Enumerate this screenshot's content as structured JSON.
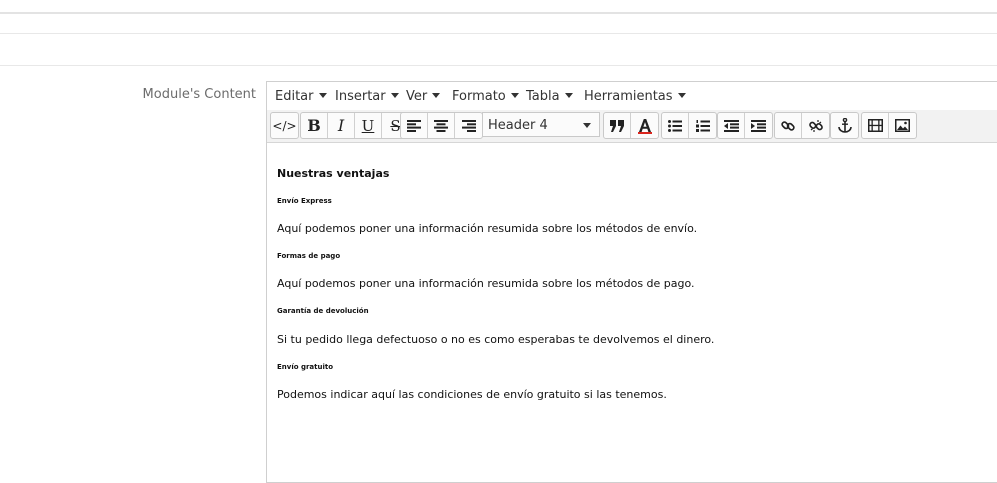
{
  "form": {
    "label": "Module's Content"
  },
  "menubar": {
    "items": [
      "Editar",
      "Insertar",
      "Ver",
      "Formato",
      "Tabla",
      "Herramientas"
    ]
  },
  "toolbar": {
    "source_code_icon": "</>",
    "bold": "B",
    "italic": "I",
    "underline": "U",
    "strikethrough": "S",
    "format_select": "Header 4",
    "icons": [
      "code-icon",
      "bold-icon",
      "italic-icon",
      "underline-icon",
      "strikethrough-icon",
      "align-left-icon",
      "align-center-icon",
      "align-right-icon",
      "blockquote-icon",
      "text-color-icon",
      "bullet-list-icon",
      "numbered-list-icon",
      "outdent-icon",
      "indent-icon",
      "link-icon",
      "unlink-icon",
      "anchor-icon",
      "media-icon",
      "image-icon"
    ],
    "text_color_accent": "#d9241c"
  },
  "content": {
    "title": "Nuestras ventajas",
    "sections": [
      {
        "heading": "Envío Express",
        "text": "Aquí podemos poner una información resumida sobre los métodos de envío."
      },
      {
        "heading": "Formas de pago",
        "text": "Aquí podemos poner una información resumida sobre los métodos de pago."
      },
      {
        "heading": "Garantía de devolución",
        "text": "Si tu pedido llega defectuoso o no es como esperabas te devolvemos el dinero."
      },
      {
        "heading": "Envío gratuito",
        "text": "Podemos indicar aquí las condiciones de envío gratuito si las tenemos."
      }
    ]
  }
}
